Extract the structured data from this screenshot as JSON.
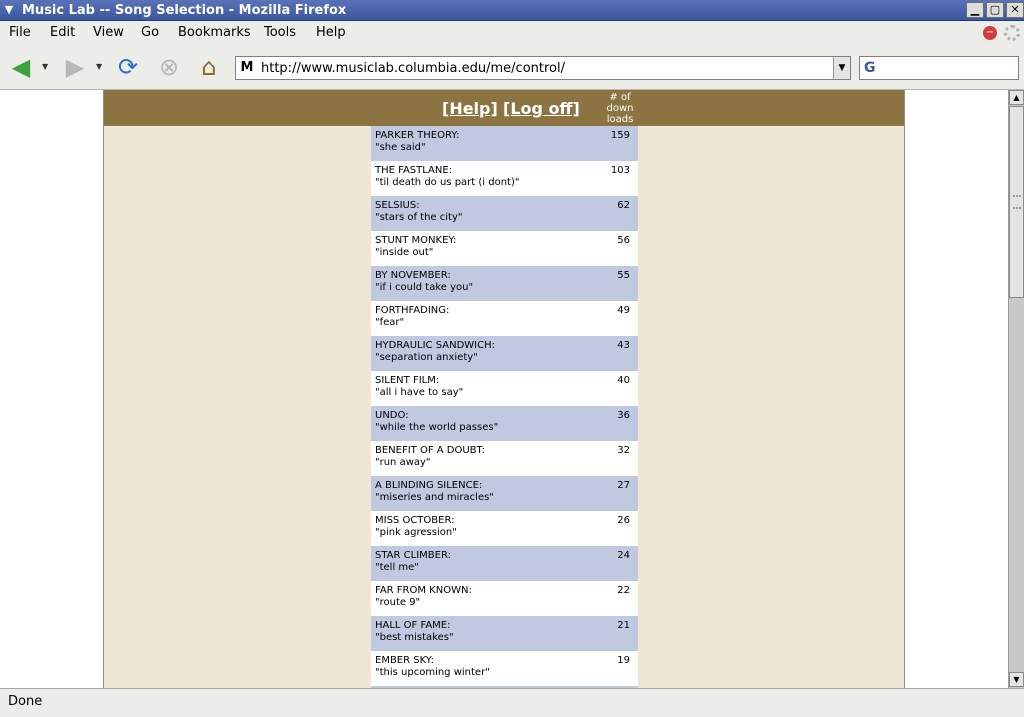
{
  "window": {
    "title": "Music Lab -- Song Selection - Mozilla Firefox",
    "minimize": "▁",
    "maximize": "▢",
    "close": "✕"
  },
  "menubar": {
    "items": [
      {
        "label": "File"
      },
      {
        "label": "Edit"
      },
      {
        "label": "View"
      },
      {
        "label": "Go"
      },
      {
        "label": "Bookmarks"
      },
      {
        "label": "Tools"
      },
      {
        "label": "Help"
      }
    ]
  },
  "navbar": {
    "back_icon": "◀",
    "forward_icon": "▶",
    "reload_icon": "⟳",
    "stop_icon": "⊗",
    "home_icon": "⌂",
    "site_icon": "M",
    "url": "http://www.musiclab.columbia.edu/me/control/",
    "search_engine_icon": "G"
  },
  "page": {
    "help_link": "[Help]",
    "logoff_link": "[Log off]",
    "downloads_header": "# of down loads",
    "songs": [
      {
        "band": "PARKER THEORY:",
        "song": "\"she said\"",
        "downloads": "159"
      },
      {
        "band": "THE FASTLANE:",
        "song": "\"til death do us part (i dont)\"",
        "downloads": "103"
      },
      {
        "band": "SELSIUS:",
        "song": "\"stars of the city\"",
        "downloads": "62"
      },
      {
        "band": "STUNT MONKEY:",
        "song": "\"inside out\"",
        "downloads": "56"
      },
      {
        "band": "BY NOVEMBER:",
        "song": "\"if i could take you\"",
        "downloads": "55"
      },
      {
        "band": "FORTHFADING:",
        "song": "\"fear\"",
        "downloads": "49"
      },
      {
        "band": "HYDRAULIC SANDWICH:",
        "song": "\"separation anxiety\"",
        "downloads": "43"
      },
      {
        "band": "SILENT FILM:",
        "song": "\"all i have to say\"",
        "downloads": "40"
      },
      {
        "band": "UNDO:",
        "song": "\"while the world passes\"",
        "downloads": "36"
      },
      {
        "band": "BENEFIT OF A DOUBT:",
        "song": "\"run away\"",
        "downloads": "32"
      },
      {
        "band": "A BLINDING SILENCE:",
        "song": "\"miseries and miracles\"",
        "downloads": "27"
      },
      {
        "band": "MISS OCTOBER:",
        "song": "\"pink agression\"",
        "downloads": "26"
      },
      {
        "band": "STAR CLIMBER:",
        "song": "\"tell me\"",
        "downloads": "24"
      },
      {
        "band": "FAR FROM KNOWN:",
        "song": "\"route 9\"",
        "downloads": "22"
      },
      {
        "band": "HALL OF FAME:",
        "song": "\"best mistakes\"",
        "downloads": "21"
      },
      {
        "band": "EMBER SKY:",
        "song": "\"this upcoming winter\"",
        "downloads": "19"
      },
      {
        "band": "",
        "song": "",
        "downloads": ""
      }
    ]
  },
  "statusbar": {
    "text": "Done"
  }
}
